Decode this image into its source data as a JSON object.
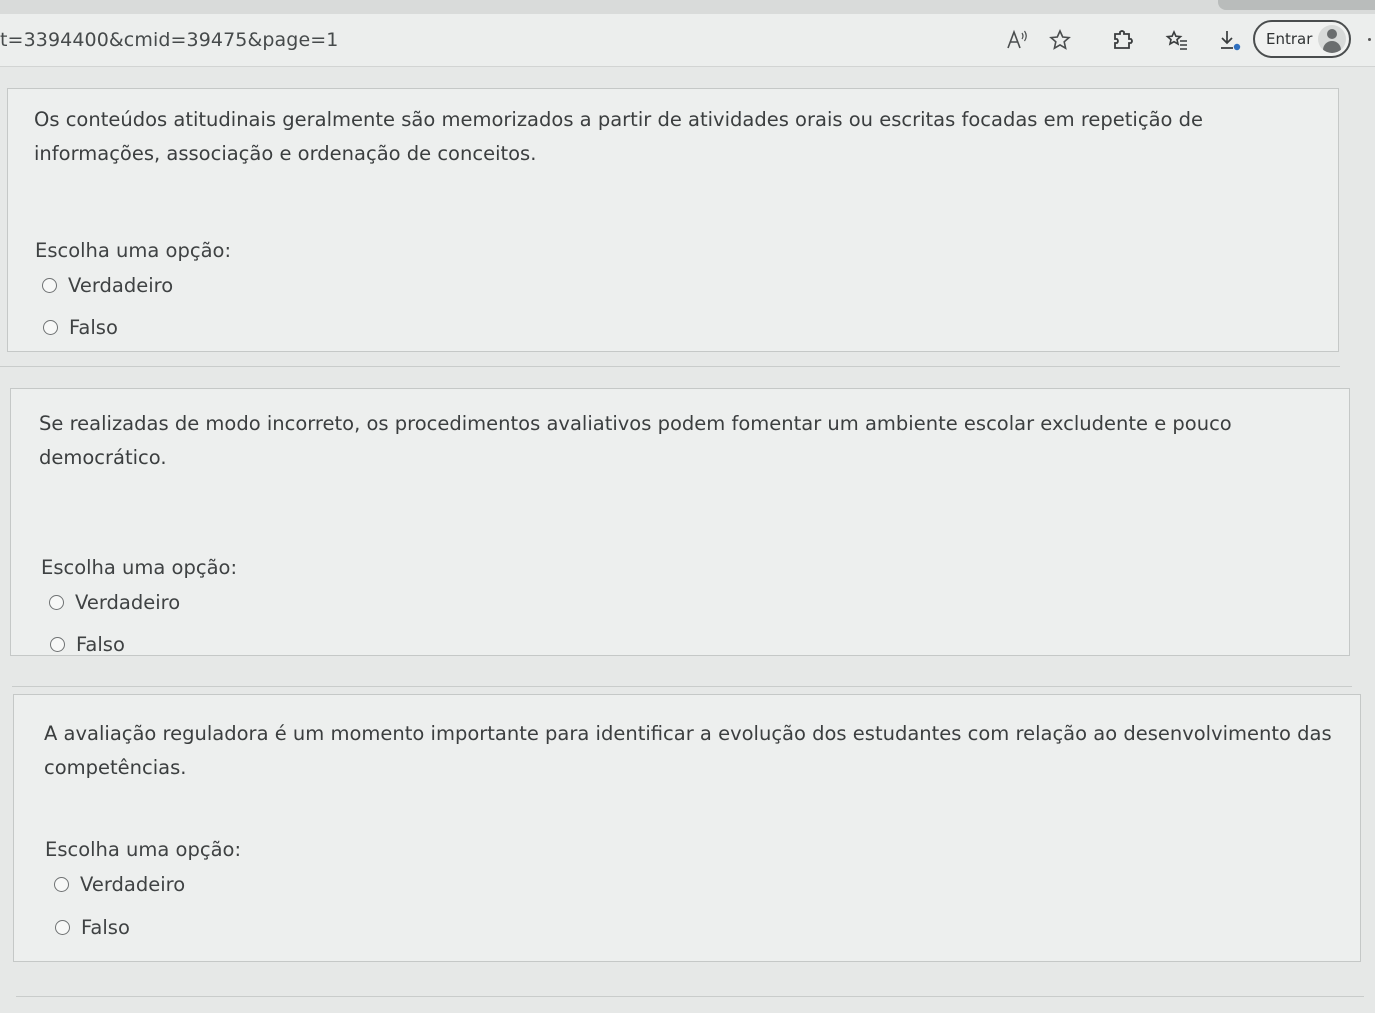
{
  "browser": {
    "url": "t=3394400&cmid=39475&page=1",
    "signin_label": "Entrar",
    "icons": [
      "read-aloud-icon",
      "favorite-star-icon",
      "extensions-icon",
      "favorites-list-icon",
      "downloads-icon",
      "avatar-icon"
    ]
  },
  "questions": [
    {
      "statement_lines": [
        "Os conteúdos atitudinais geralmente são memorizados a partir de atividades orais ou escritas focadas em repetição de",
        "informações, associação e ordenação de conceitos."
      ],
      "prompt": "Escolha uma opção:",
      "options": [
        "Verdadeiro",
        "Falso"
      ]
    },
    {
      "statement_lines": [
        "Se realizadas de modo incorreto, os procedimentos avaliativos podem fomentar um ambiente escolar excludente e pouco",
        "democrático."
      ],
      "prompt": "Escolha uma opção:",
      "options": [
        "Verdadeiro",
        "Falso"
      ]
    },
    {
      "statement_lines": [
        "A avaliação reguladora é um momento importante para identificar a evolução dos estudantes com relação ao desenvolvimento das",
        "competências."
      ],
      "prompt": "Escolha uma opção:",
      "options": [
        "Verdadeiro",
        "Falso"
      ]
    }
  ]
}
